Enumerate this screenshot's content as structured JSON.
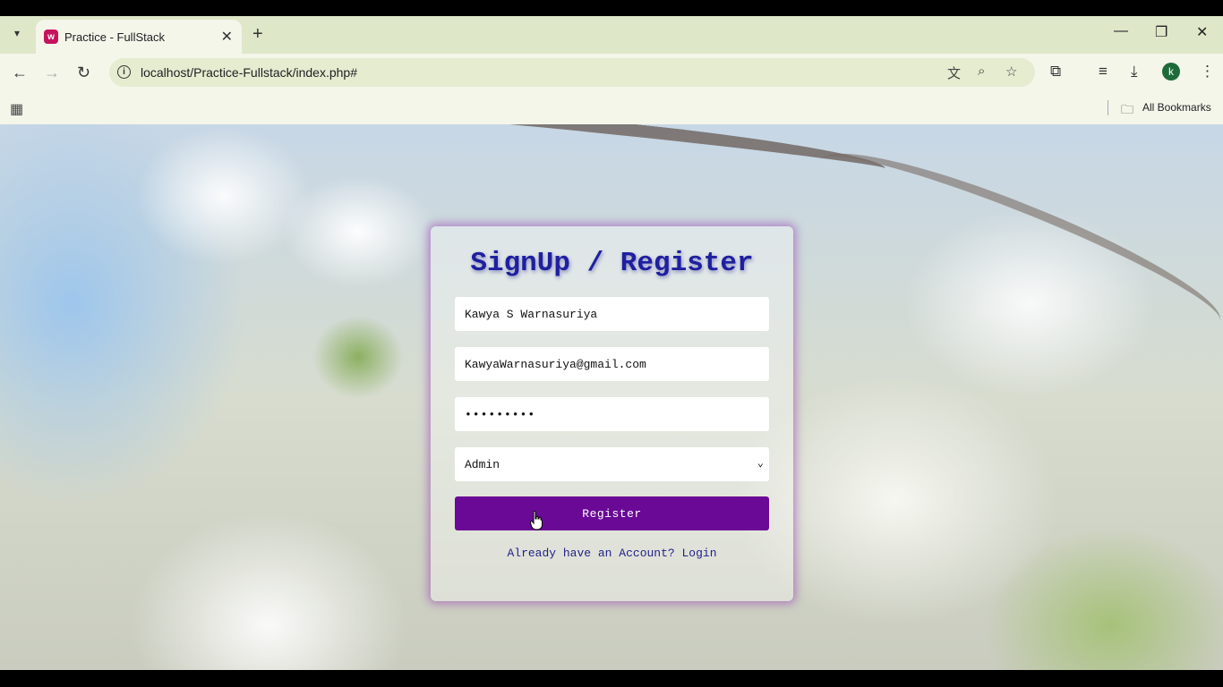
{
  "browser": {
    "tab_title": "Practice - FullStack",
    "url": "localhost/Practice-Fullstack/index.php#",
    "profile_initial": "k",
    "bookmarks_label": "All Bookmarks"
  },
  "form": {
    "title": "SignUp / Register",
    "name_value": "Kawya S Warnasuriya",
    "email_value": "KawyaWarnasuriya@gmail.com",
    "password_mask": "•••••••••",
    "role_selected": "Admin",
    "register_label": "Register",
    "login_link": "Already have an Account? Login"
  }
}
